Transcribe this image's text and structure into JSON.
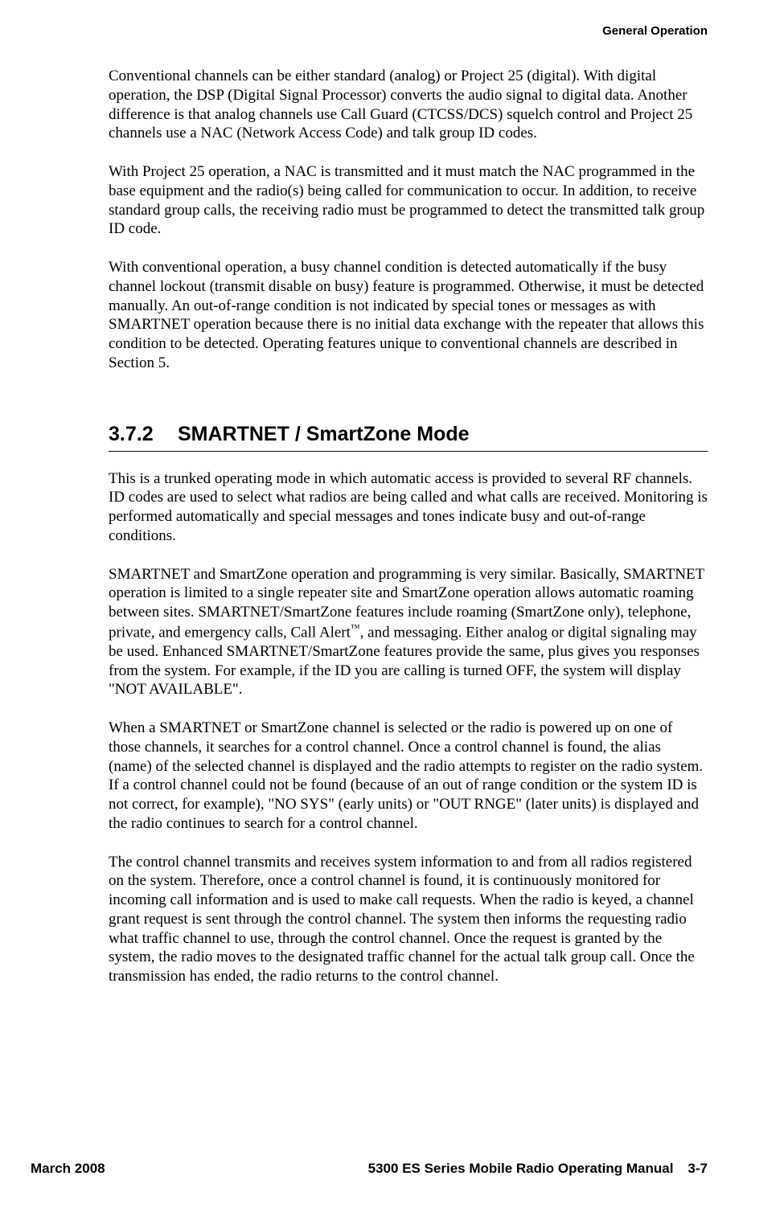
{
  "header": {
    "sectionTitle": "General Operation"
  },
  "paragraphs": {
    "p1": "Conventional channels can be either standard (analog) or Project 25 (digital). With digital operation, the DSP (Digital Signal Processor) converts the audio signal to digital data. Another difference is that analog channels use Call Guard (CTCSS/DCS) squelch control and Project 25 channels use a NAC (Network Access Code) and talk group ID codes.",
    "p2": "With Project 25 operation, a NAC is transmitted and it must match the NAC programmed in the base equipment and the radio(s) being called for communication to occur. In addition, to receive standard group calls, the receiving radio must be programmed to detect the transmitted talk group ID code.",
    "p3": "With conventional operation, a busy channel condition is detected automatically if the busy channel lockout (transmit disable on busy) feature is programmed. Otherwise, it must be detected manually. An out-of-range condition is not indicated by special tones or messages as with SMARTNET operation because there is no initial data exchange with the repeater that allows this condition to be detected. Operating features unique to conventional channels are described in Section 5.",
    "p4": "This is a trunked operating mode in which automatic access is provided to several RF channels. ID codes are used to select what radios are being called and what calls are received. Monitoring is performed automatically and special messages and tones indicate busy and out-of-range conditions.",
    "p5a": "SMARTNET and SmartZone operation and programming is very similar. Basically, SMARTNET operation is limited to a single repeater site and SmartZone operation allows automatic roaming between sites. SMARTNET/SmartZone features include roaming (SmartZone only), telephone, private, and emergency calls, Call Alert",
    "p5b": ", and messaging. Either analog or digital signaling may be used. Enhanced SMARTNET/SmartZone features provide the same, plus gives you responses from the system. For example, if the ID you are calling is turned OFF, the system will display \"NOT AVAILABLE\".",
    "tm": "™",
    "p6": "When a SMARTNET or SmartZone channel is selected or the radio is powered up on one of those channels, it searches for a control channel. Once a control channel is found, the alias (name) of the selected channel is displayed and the radio attempts to register on the radio system. If a control channel could not be found (because of an out of range condition or the system ID is not correct, for example), \"NO SYS\" (early units) or \"OUT RNGE\" (later units) is displayed and the radio continues to search for a control channel.",
    "p7": "The control channel transmits and receives system information to and from all radios registered on the system. Therefore, once a control channel is found, it is continuously monitored for incoming call information and is used to make call requests. When the radio is keyed, a channel grant request is sent through the control channel. The system then informs the requesting radio what traffic channel to use, through the control channel. Once the request is granted by the system, the radio moves to the designated traffic channel for the actual talk group call. Once the transmission has ended, the radio returns to the control channel."
  },
  "section": {
    "number": "3.7.2",
    "title": "SMARTNET / SmartZone Mode"
  },
  "footer": {
    "date": "March 2008",
    "manualTitle": "5300 ES Series Mobile Radio Operating Manual",
    "pageNumber": "3-7"
  }
}
